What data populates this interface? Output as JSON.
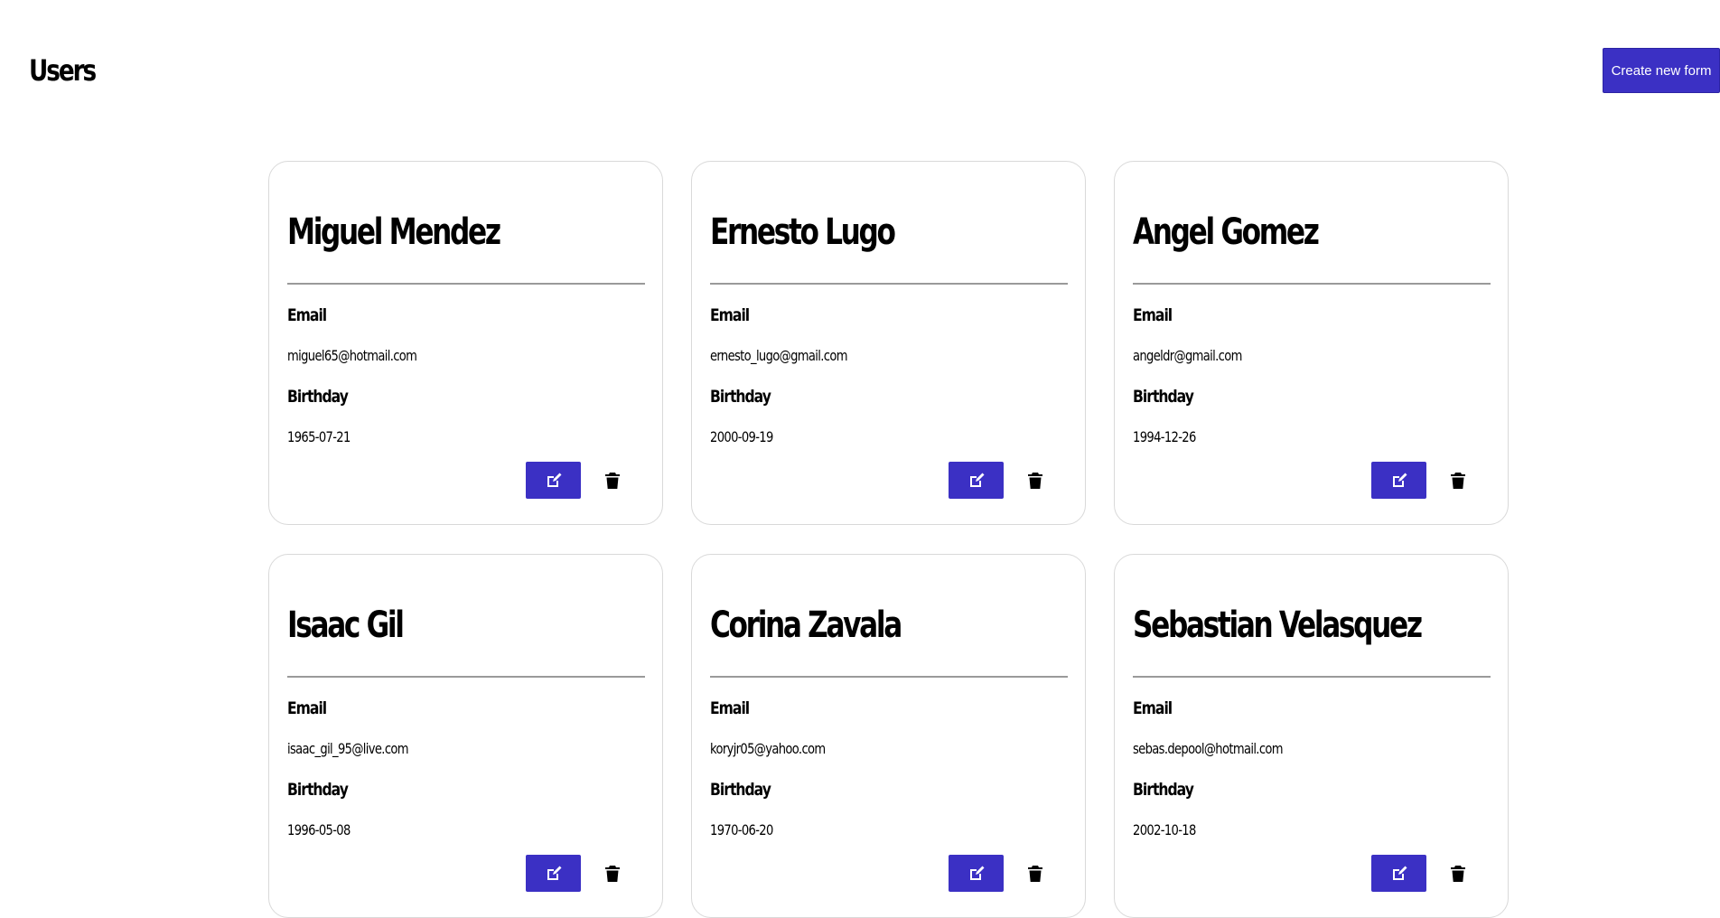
{
  "header": {
    "title": "Users",
    "create_button_label": "Create new form"
  },
  "labels": {
    "email": "Email",
    "birthday": "Birthday"
  },
  "icons": {
    "edit": "edit-icon",
    "delete": "trash-icon"
  },
  "colors": {
    "accent": "#3b30c4",
    "card_border": "#d9d9d9",
    "divider": "#9a9a9a"
  },
  "users": [
    {
      "name": "Miguel Mendez",
      "email": "miguel65@hotmail.com",
      "birthday": "1965-07-21"
    },
    {
      "name": "Ernesto Lugo",
      "email": "ernesto_lugo@gmail.com",
      "birthday": "2000-09-19"
    },
    {
      "name": "Angel Gomez",
      "email": "angeldr@gmail.com",
      "birthday": "1994-12-26"
    },
    {
      "name": "Isaac Gil",
      "email": "isaac_gil_95@live.com",
      "birthday": "1996-05-08"
    },
    {
      "name": "Corina Zavala",
      "email": "koryjr05@yahoo.com",
      "birthday": "1970-06-20"
    },
    {
      "name": "Sebastian Velasquez",
      "email": "sebas.depool@hotmail.com",
      "birthday": "2002-10-18"
    }
  ]
}
